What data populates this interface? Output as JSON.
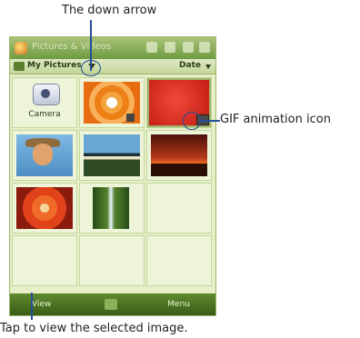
{
  "annotations": {
    "top": "The down arrow",
    "right": "GIF animation icon",
    "bottom": "Tap to view the selected image."
  },
  "window": {
    "title": "Pictures & Videos"
  },
  "toolbar": {
    "folder_label": "My Pictures",
    "sort_label": "Date"
  },
  "grid": {
    "camera_label": "Camera"
  },
  "softkeys": {
    "left": "View",
    "right": "Menu"
  },
  "colors": {
    "accent": "#6f9a40",
    "callout": "#244e9a"
  }
}
